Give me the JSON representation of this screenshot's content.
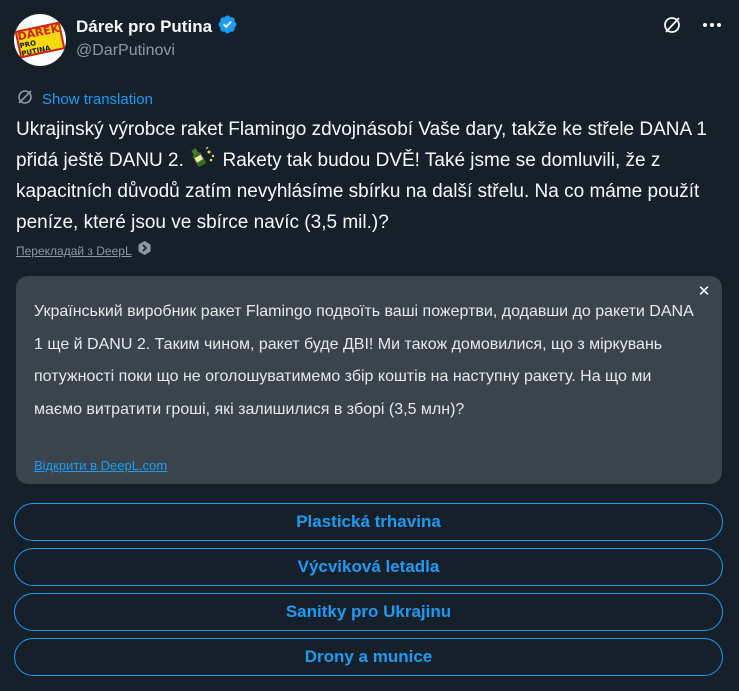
{
  "author": {
    "display_name": "Dárek pro Putina",
    "handle": "@DarPutinovi",
    "avatar_text_line1": "DÁREK",
    "avatar_text_line2": "PRO PUTINA"
  },
  "show_translation_label": "Show translation",
  "tweet_text_part1": "Ukrajinský výrobce raket Flamingo zdvojnásobí Vaše dary, takže ke střele DANA 1 přidá ještě DANU 2.",
  "tweet_text_part2": " Rakety tak budou DVĚ! Také jsme se domluvili, že z kapacitních důvodů zatím nevyhlásíme sbírku na další střelu. Na co máme použít peníze, které jsou ve sbírce navíc (3,5 mil.)?",
  "deepl_label": "Перекладай з DeepL",
  "translation": {
    "text": "Український виробник ракет Flamingo подвоїть ваші пожертви, додавши до ракети DANA 1 ще й DANU 2.  Таким чином, ракет буде ДВІ! Ми також домовилися, що з міркувань потужності поки що не оголошуватимемо збір коштів на наступну ракету. На що ми маємо витратити гроші, які залишилися в зборі (3,5 млн)?",
    "open_link": "Відкрити в DeepL.com",
    "close_glyph": "✕"
  },
  "poll_options": [
    "Plastická trhavina",
    "Výcviková letadla",
    "Sanitky pro Ukrajinu",
    "Drony a munice"
  ],
  "colors": {
    "background": "#15202b",
    "accent": "#1d9bf0",
    "translation_bg": "#3a444c",
    "muted": "#8b98a5"
  }
}
